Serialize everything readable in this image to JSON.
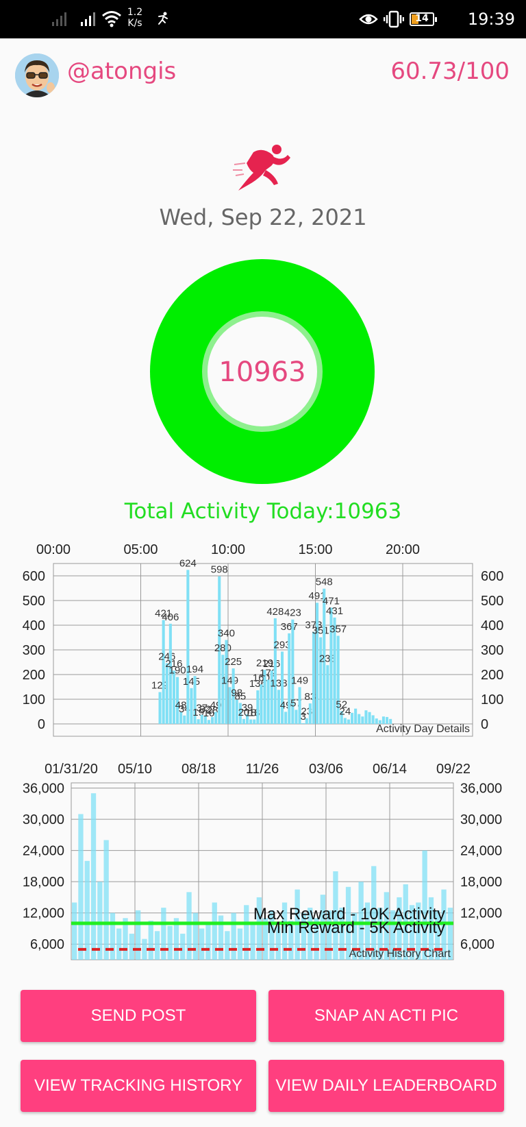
{
  "status_bar": {
    "speed_value": "1.2",
    "speed_unit": "K/s",
    "battery": "14",
    "time": "19:39",
    "icons": [
      "signal-icon",
      "signal-icon",
      "wifi-icon",
      "running-notification-icon",
      "eye-icon",
      "vibrate-icon",
      "battery-icon"
    ]
  },
  "header": {
    "username": "@atongis",
    "score": "60.73/100"
  },
  "activity": {
    "icon": "running-man-icon",
    "date": "Wed, Sep 22, 2021",
    "ring_value": "10963",
    "total_label": "Total Activity Today:",
    "total_value": "10963",
    "ring_color": "#00ee00",
    "accent": "#e5487f"
  },
  "chart_data": [
    {
      "type": "bar",
      "title": "Activity Day Details",
      "x_ticks": [
        "00:00",
        "05:00",
        "10:00",
        "15:00",
        "20:00"
      ],
      "y_ticks": [
        "0",
        "100",
        "200",
        "300",
        "400",
        "500",
        "600"
      ],
      "ylim": [
        0,
        650
      ],
      "xlim": [
        0,
        24
      ],
      "bar_color": "#80e0f5",
      "x": [
        6.1,
        6.3,
        6.5,
        6.7,
        6.9,
        7.1,
        7.3,
        7.5,
        7.7,
        7.9,
        8.1,
        8.3,
        8.5,
        8.7,
        8.9,
        9.1,
        9.3,
        9.5,
        9.7,
        9.9,
        10.1,
        10.3,
        10.5,
        10.7,
        10.9,
        11.1,
        11.3,
        11.5,
        11.7,
        11.9,
        12.1,
        12.3,
        12.5,
        12.7,
        12.9,
        13.1,
        13.3,
        13.5,
        13.7,
        13.9,
        14.1,
        14.3,
        14.5,
        14.7,
        14.9,
        15.1,
        15.3,
        15.5,
        15.7,
        15.9,
        16.1,
        16.3,
        16.5,
        16.7,
        16.9,
        17.1,
        17.3,
        17.5,
        17.7,
        17.9,
        18.1,
        18.3,
        18.5,
        18.7,
        18.9,
        19.1,
        19.3
      ],
      "values": [
        129,
        421,
        246,
        406,
        216,
        190,
        48,
        34,
        624,
        145,
        194,
        19,
        37,
        32,
        16,
        28,
        49,
        598,
        280,
        340,
        149,
        225,
        98,
        85,
        20,
        39,
        18,
        18,
        136,
        160,
        219,
        179,
        216,
        428,
        138,
        293,
        49,
        367,
        423,
        57,
        149,
        3,
        23,
        83,
        373,
        491,
        351,
        548,
        238,
        471,
        431,
        357,
        52,
        24,
        18,
        45,
        62,
        40,
        30,
        55,
        48,
        35,
        22,
        15,
        30,
        28,
        20
      ]
    },
    {
      "type": "bar",
      "title": "Activity History Chart",
      "x_ticks": [
        "01/31/20",
        "05/10",
        "08/18",
        "11/26",
        "03/06",
        "06/14",
        "09/22"
      ],
      "y_ticks": [
        "6,000",
        "12,000",
        "18,000",
        "24,000",
        "30,000",
        "36,000"
      ],
      "ylim": [
        3000,
        37000
      ],
      "bar_color": "#80e0f5",
      "reference_lines": [
        {
          "label": "Max Reward - 10K Activity",
          "value": 10000,
          "color": "#22ee22",
          "style": "solid"
        },
        {
          "label": "Min Reward - 5K Activity",
          "value": 5000,
          "color": "#dd2222",
          "style": "dashed"
        }
      ],
      "values": [
        14000,
        31000,
        22000,
        35000,
        18000,
        26000,
        12000,
        9000,
        11000,
        8000,
        12500,
        7000,
        10500,
        8500,
        13000,
        9500,
        11000,
        8000,
        16000,
        12000,
        9000,
        10000,
        14000,
        11500,
        8500,
        12000,
        9000,
        13500,
        10000,
        15000,
        11000,
        12500,
        9500,
        14000,
        10500,
        16500,
        12000,
        13000,
        11000,
        15500,
        12500,
        20000,
        13000,
        17000,
        12000,
        18000,
        14000,
        21000,
        13000,
        16000,
        12500,
        15000,
        17500,
        13500,
        14000,
        24000,
        15000,
        12500,
        16500,
        13000
      ]
    }
  ],
  "buttons": {
    "send_post": "SEND POST",
    "snap_pic": "SNAP AN ACTI PIC",
    "view_history": "VIEW TRACKING HISTORY",
    "view_leaderboard": "VIEW DAILY LEADERBOARD"
  }
}
